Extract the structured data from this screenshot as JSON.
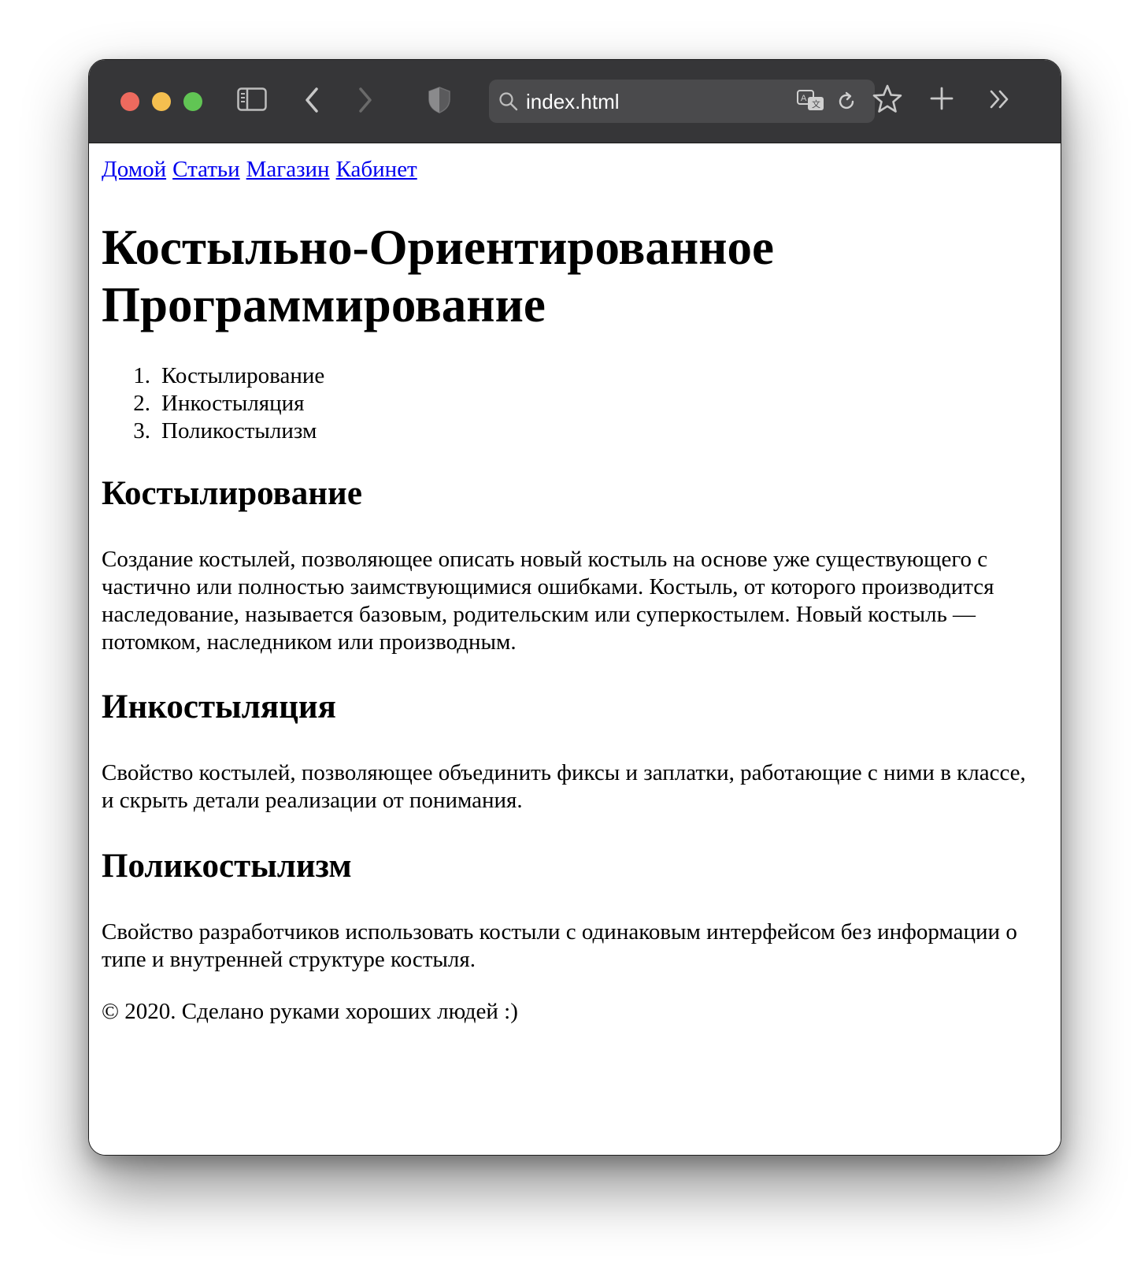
{
  "browser": {
    "address_text": "index.html",
    "icons": [
      "sidebar-icon",
      "back-icon",
      "forward-icon",
      "shield-icon",
      "search-icon",
      "translate-icon",
      "reload-icon",
      "bookmark-star-icon",
      "new-tab-icon",
      "overflow-chevrons-icon"
    ]
  },
  "page": {
    "nav": [
      "Домой",
      "Статьи",
      "Магазин",
      "Кабинет"
    ],
    "title_line1": "Костыльно-Ориентированное",
    "title_line2": "Программирование",
    "toc": [
      {
        "num": "1.",
        "text": "Костылирование"
      },
      {
        "num": "2.",
        "text": "Инкостыляция"
      },
      {
        "num": "3.",
        "text": "Поликостылизм"
      }
    ],
    "sections": [
      {
        "heading": "Костылирование",
        "text": "Создание костылей, позволяющее описать новый костыль на основе уже существующего с частично или полностью заимствующимися ошибками. Костыль, от которого производится наследование, называется базовым, родительским или суперкостылем. Новый костыль — потомком, наследником или производным."
      },
      {
        "heading": "Инкостыляция",
        "text": "Свойство костылей, позволяющее объединить фиксы и заплатки, работающие с ними в классе, и скрыть детали реализации от понимания."
      },
      {
        "heading": "Поликостылизм",
        "text": "Свойство разработчиков использовать костыли с одинаковым интерфейсом без информации о типе и внутренней структуре костыля."
      }
    ],
    "footer": "© 2020. Сделано руками хороших людей :)"
  }
}
